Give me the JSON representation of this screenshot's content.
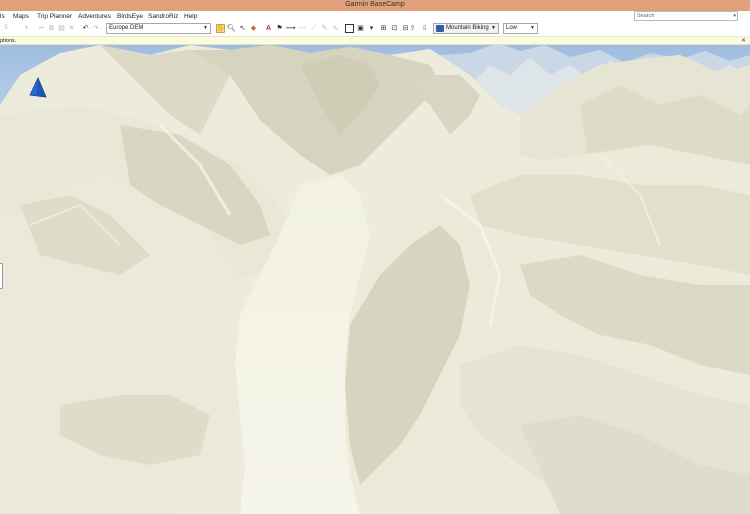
{
  "window": {
    "title": "Garmin BaseCamp"
  },
  "menu": [
    "ls",
    "Maps",
    "Trip Planner",
    "Adventures",
    "BirdsEye",
    "SandroRiz",
    "Help"
  ],
  "search": {
    "placeholder": "Search"
  },
  "toolbar": {
    "history_count": "5",
    "map_product": "Europe DEM",
    "activity_profile": "Mountain Biking",
    "detail_level": "Low"
  },
  "infobar": {
    "message": "ptions."
  },
  "colors": {
    "titlebar": "#dfa07a",
    "terrain": "#eeeedd",
    "terrain_shadow": "#c9c8b0",
    "sky": "#a9c4e0",
    "marker": "#2a6bd1"
  },
  "icons": [
    "undo-icon",
    "redo-icon",
    "cut-icon",
    "copy-icon",
    "paste-icon",
    "delete-icon",
    "pan-icon",
    "zoom-icon",
    "select-icon",
    "erase-icon",
    "text-icon",
    "waypoint-icon",
    "route-icon",
    "track-icon",
    "map-view-icon",
    "3d-view-icon",
    "tile-icon",
    "photo-icon",
    "send-to-device-icon",
    "receive-from-device-icon",
    "position-marker-icon"
  ]
}
